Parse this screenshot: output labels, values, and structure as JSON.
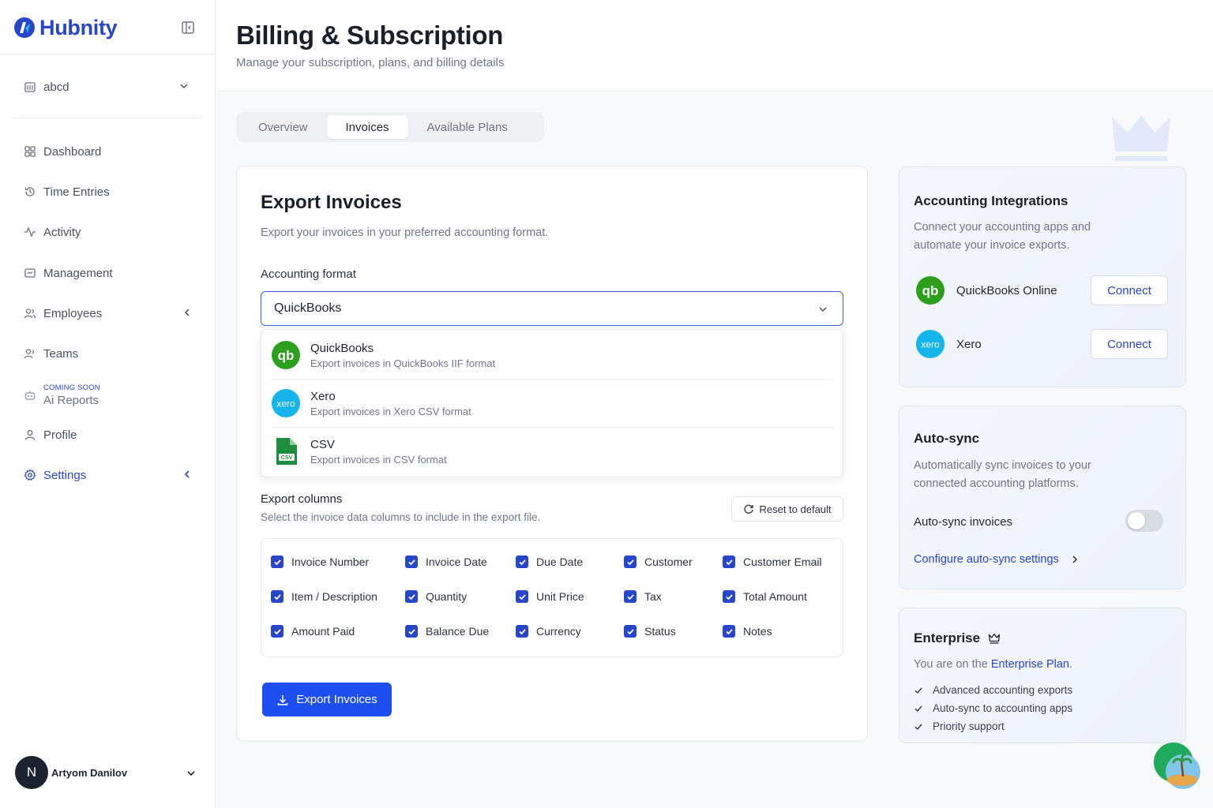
{
  "brand": {
    "name": "Hubnity",
    "accent": "#2746c9",
    "primary_button": "#1d4ff0"
  },
  "sidebar": {
    "workspace": "abcd",
    "items": [
      {
        "label": "Dashboard",
        "icon": "grid-icon"
      },
      {
        "label": "Time Entries",
        "icon": "history-icon"
      },
      {
        "label": "Activity",
        "icon": "activity-icon"
      },
      {
        "label": "Management",
        "icon": "folder-icon"
      },
      {
        "label": "Employees",
        "icon": "users-icon"
      },
      {
        "label": "Teams",
        "icon": "team-icon"
      },
      {
        "label": "Ai Reports",
        "tag": "COMING SOON",
        "icon": "robot-icon"
      },
      {
        "label": "Profile",
        "icon": "user-icon"
      },
      {
        "label": "Settings",
        "icon": "gear-icon",
        "active": true
      }
    ],
    "user": {
      "initial": "N",
      "name": "Artyom Danilov"
    }
  },
  "header": {
    "title": "Billing & Subscription",
    "subtitle": "Manage your subscription, plans, and billing details"
  },
  "tabs": [
    {
      "label": "Overview",
      "active": false
    },
    {
      "label": "Invoices",
      "active": true
    },
    {
      "label": "Available Plans",
      "active": false
    }
  ],
  "export": {
    "title": "Export Invoices",
    "description": "Export your invoices in your preferred accounting format.",
    "format_label": "Accounting format",
    "selected_format": "QuickBooks",
    "options": [
      {
        "title": "QuickBooks",
        "desc": "Export invoices in QuickBooks IIF format"
      },
      {
        "title": "Xero",
        "desc": "Export invoices in Xero CSV format"
      },
      {
        "title": "CSV",
        "desc": "Export invoices in CSV format"
      }
    ],
    "columns_title": "Export columns",
    "columns_desc": "Select the invoice data columns to include in the export file.",
    "reset_label": "Reset to default",
    "columns": [
      [
        "Invoice Number",
        "Invoice Date",
        "Due Date",
        "Customer",
        "Customer Email"
      ],
      [
        "Item / Description",
        "Quantity",
        "Unit Price",
        "Tax",
        "Total Amount"
      ],
      [
        "Amount Paid",
        "Balance Due",
        "Currency",
        "Status",
        "Notes"
      ]
    ],
    "button_label": "Export Invoices"
  },
  "integrations": {
    "title": "Accounting Integrations",
    "desc_line1": "Connect your accounting apps and",
    "desc_line2": "automate your invoice exports.",
    "apps": [
      {
        "name": "QuickBooks Online",
        "action": "Connect"
      },
      {
        "name": "Xero",
        "action": "Connect"
      }
    ]
  },
  "autosync": {
    "title": "Auto-sync",
    "desc_line1": "Automatically sync invoices to your",
    "desc_line2": "connected accounting platforms.",
    "toggle_label": "Auto-sync invoices",
    "enabled": false,
    "link": "Configure auto-sync settings"
  },
  "enterprise": {
    "title": "Enterprise",
    "text_prefix": "You are on the ",
    "plan": "Enterprise Plan",
    "text_suffix": ".",
    "features": [
      "Advanced accounting exports",
      "Auto-sync to accounting apps",
      "Priority support"
    ]
  },
  "icons": {
    "quickbooks_logo": "#2ca01c",
    "xero_logo": "#13b5ea",
    "csv_logo": "#1e8e3e"
  }
}
